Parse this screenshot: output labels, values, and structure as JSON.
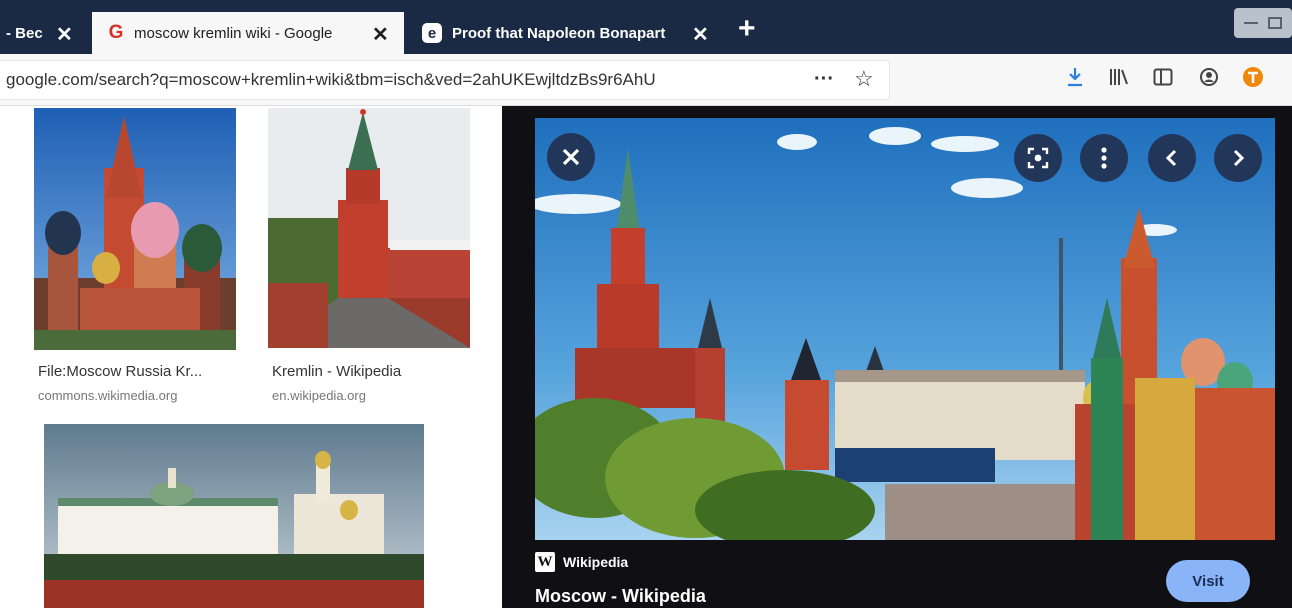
{
  "browser": {
    "tabs": [
      {
        "title": "- Bec",
        "active": false
      },
      {
        "title": "moscow kremlin wiki - Google",
        "active": true,
        "icon": "google-g-icon"
      },
      {
        "title": "Proof that Napoleon Bonapart",
        "active": false,
        "icon": "extension-icon"
      }
    ],
    "close_glyph": "✕",
    "new_tab_glyph": "+",
    "url": "google.com/search?q=moscow+kremlin+wiki&tbm=isch&ved=2ahUKEwjltdzBs9r6AhU",
    "toolbar_icons": [
      "download-icon",
      "library-icon",
      "sidebar-icon",
      "account-icon",
      "extension-orange-icon"
    ]
  },
  "results": [
    {
      "title": "File:Moscow Russia Kr...",
      "source": "commons.wikimedia.org"
    },
    {
      "title": "Kremlin - Wikipedia",
      "source": "en.wikipedia.org"
    }
  ],
  "preview": {
    "source_name": "Wikipedia",
    "source_logo": "W",
    "title": "Moscow - Wikipedia",
    "visit_label": "Visit",
    "buttons": [
      "close-icon",
      "lens-icon",
      "more-vertical-icon",
      "chevron-left-icon",
      "chevron-right-icon"
    ]
  },
  "colors": {
    "tab_bar": "#1b2a44",
    "preview_bg": "#101014",
    "preview_button": "#223659",
    "visit_button": "#8ab4f8"
  }
}
